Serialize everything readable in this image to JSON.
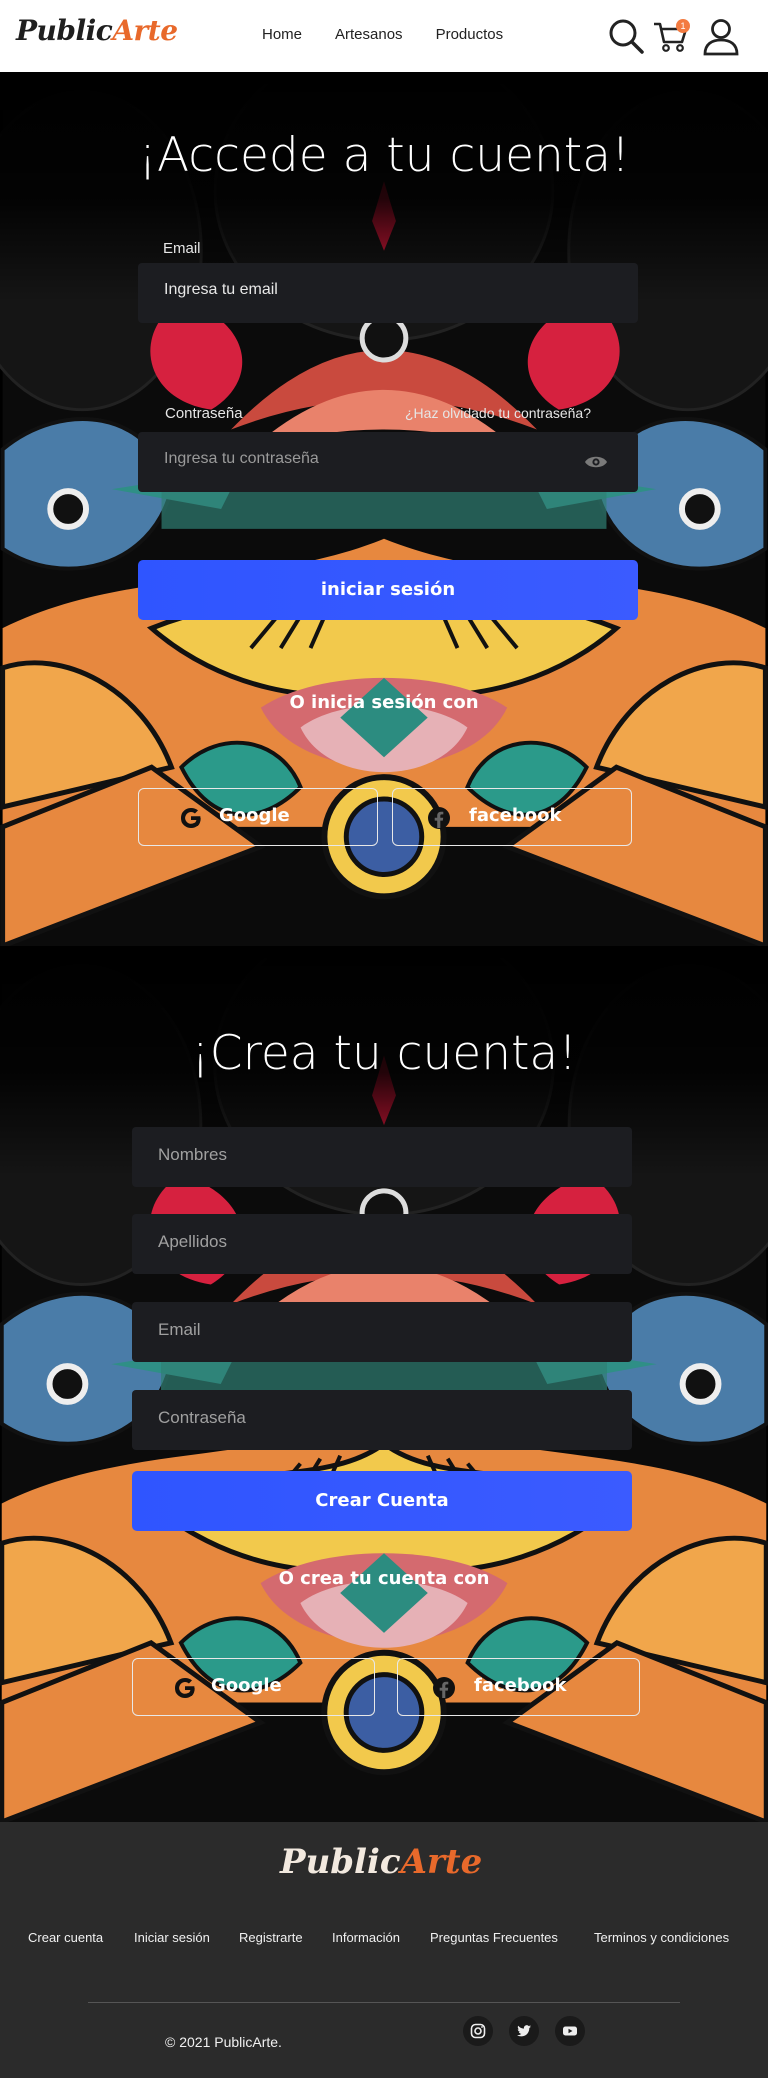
{
  "header": {
    "logo": {
      "part1": "Public",
      "part2": "Arte"
    },
    "nav": [
      "Home",
      "Artesanos",
      "Productos"
    ],
    "cart_count": "1",
    "icons": [
      "search-icon",
      "cart-icon",
      "user-icon"
    ]
  },
  "login": {
    "title": "¡Accede a tu cuenta!",
    "email_label": "Email",
    "email_placeholder": "Ingresa tu email",
    "password_label": "Contraseña",
    "forgot_link": "¿Haz olvidado tu contraseña?",
    "password_placeholder": "Ingresa tu contraseña",
    "submit": "iniciar sesión",
    "alt_text": "O inicia sesión con",
    "google": "Google",
    "facebook": "facebook"
  },
  "register": {
    "title": "¡Crea tu cuenta!",
    "names_placeholder": "Nombres",
    "lastnames_placeholder": "Apellidos",
    "email_placeholder": "Email",
    "password_placeholder": "Contraseña",
    "submit": "Crear Cuenta",
    "alt_text": "O crea tu cuenta con",
    "google": "Google",
    "facebook": "facebook"
  },
  "footer": {
    "logo": {
      "part1": "Public",
      "part2": "Arte"
    },
    "links": [
      "Crear cuenta",
      "Iniciar sesión",
      "Registrarte",
      "Información",
      "Preguntas Frecuentes",
      "Terminos y condiciones"
    ],
    "copyright": "© 2021 PublicArte.",
    "social": [
      "instagram-icon",
      "twitter-icon",
      "youtube-icon"
    ]
  },
  "colors": {
    "accent": "#2f55ff",
    "brand_orange": "#e8692b",
    "field_bg": "#1c1d21",
    "footer_bg": "#2b2b2b"
  }
}
